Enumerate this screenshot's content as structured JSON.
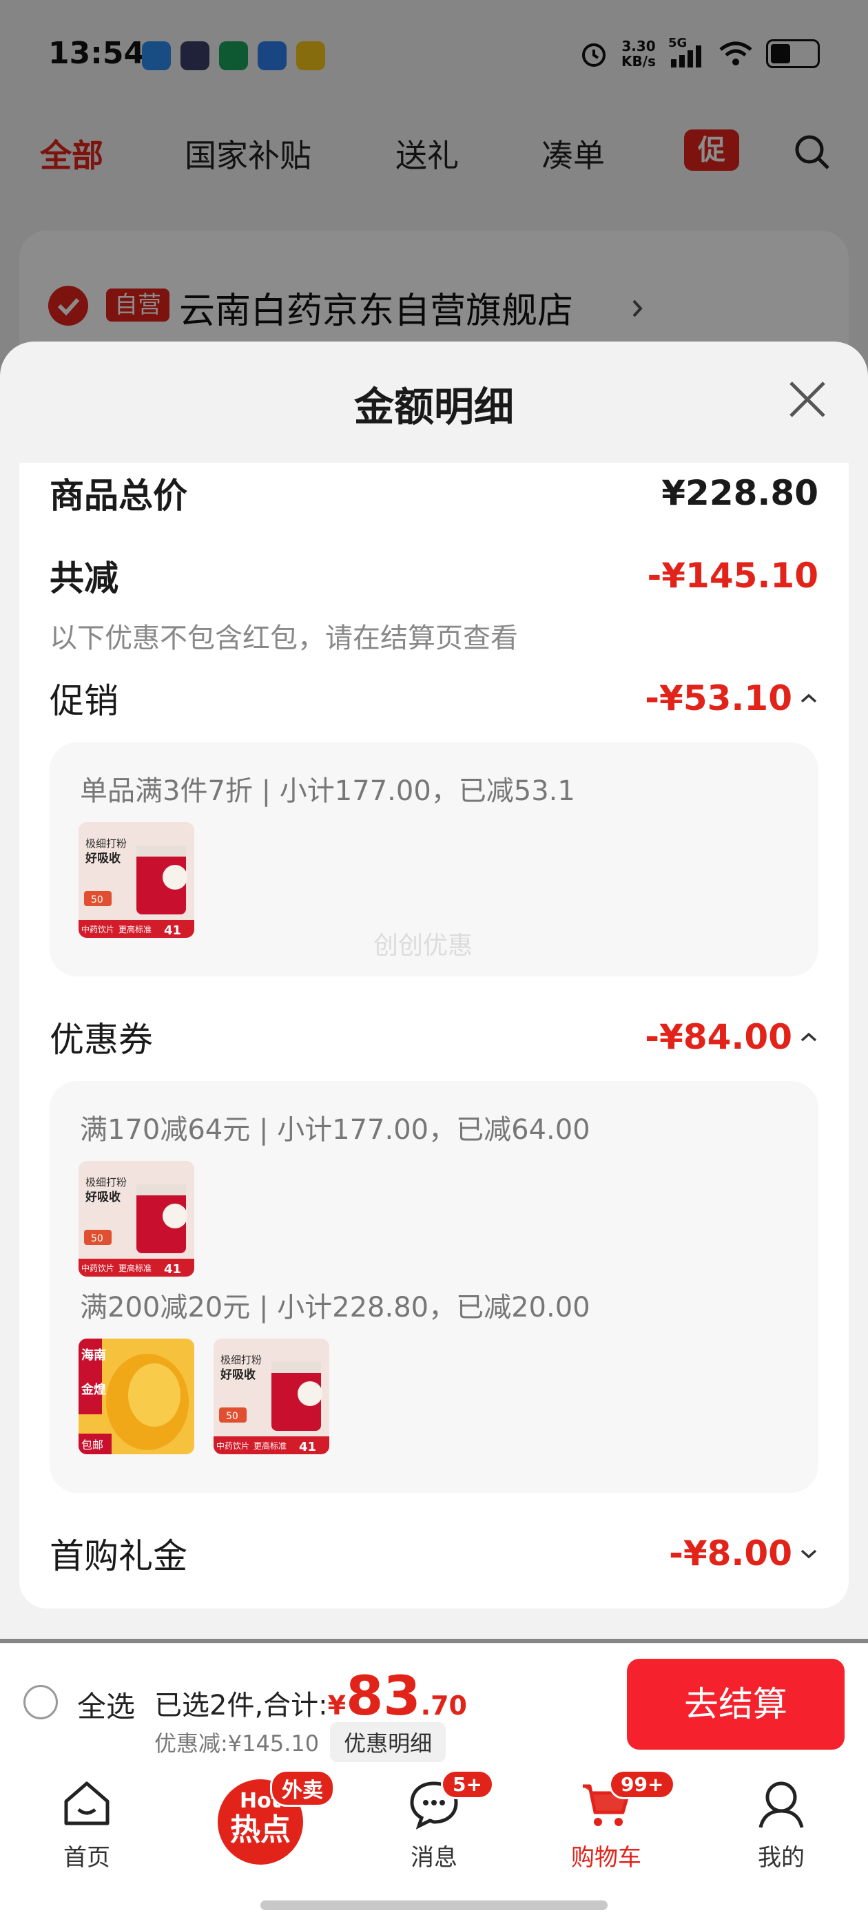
{
  "status_bar": {
    "time": "13:54",
    "net_speed_value": "3.30",
    "net_speed_unit": "KB/s",
    "signal": "5G",
    "icons": [
      "alarm-icon",
      "wifi-icon",
      "battery-icon"
    ]
  },
  "top_tabs": {
    "items": [
      "全部",
      "国家补贴",
      "送礼",
      "凑单"
    ],
    "active_index": 0,
    "promo_label": "促"
  },
  "shop": {
    "badge": "自营",
    "name": "云南白药京东自营旗舰店"
  },
  "sheet": {
    "title": "金额明细",
    "total_label": "商品总价",
    "total_value": "¥228.80",
    "reduce_label": "共减",
    "reduce_value": "-¥145.10",
    "note": "以下优惠不包含红包，请在结算页查看",
    "promo_label": "促销",
    "promo_value": "-¥53.10",
    "promo_detail": "单品满3件7折 | 小计177.00，已减53.1",
    "watermark": "创创优惠",
    "coupon_label": "优惠券",
    "coupon_value": "-¥84.00",
    "coupon_detail_1": "满170减64元 | 小计177.00，已减64.00",
    "coupon_detail_2": "满200减20元 | 小计228.80，已减20.00",
    "first_gift_label": "首购礼金",
    "first_gift_value": "-¥8.00"
  },
  "product_thumb": {
    "line1": "极细打粉",
    "line2": "好吸收",
    "tag_50": "50",
    "bottom_left": "中药饮片",
    "bottom_mid": "更高标准",
    "bottom_right": "41"
  },
  "mango_thumb": {
    "line1": "海南",
    "line2": "金煌",
    "bottom": "包邮"
  },
  "bottom_bar": {
    "select_all": "全选",
    "selected_text": "已选2件,合计:",
    "currency": "¥",
    "total_int": "83",
    "total_dec": ".70",
    "discount_text": "优惠减:¥145.10",
    "discount_btn": "优惠明细",
    "checkout": "去结算"
  },
  "tab_bar": {
    "home": "首页",
    "hot_top": "Hot",
    "hot_main": "热点",
    "hot_badge": "外卖",
    "messages": "消息",
    "messages_badge": "5+",
    "cart": "购物车",
    "cart_badge": "99+",
    "mine": "我的"
  },
  "colors": {
    "accent_red": "#e2231a",
    "checkout_red": "#f5222d"
  }
}
